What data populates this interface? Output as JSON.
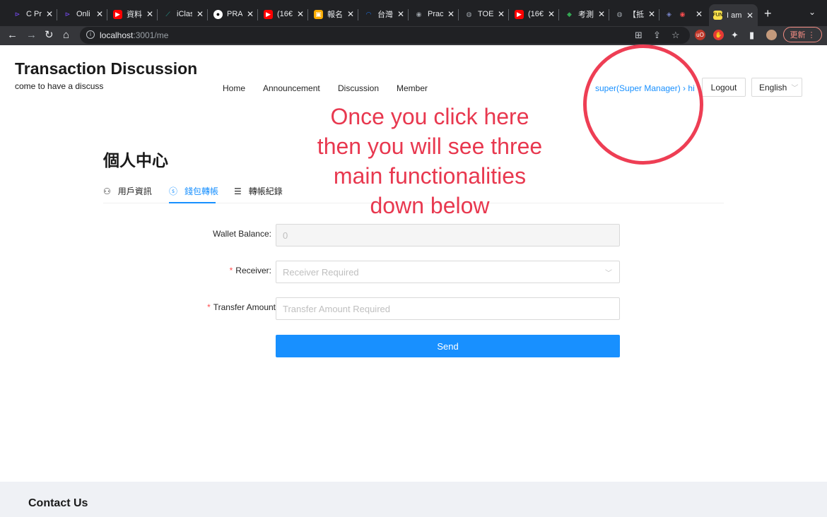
{
  "browser": {
    "tabs": [
      {
        "label": "C Pr",
        "icon": "purple-p-icon",
        "color": "#7c4dff"
      },
      {
        "label": "Onli",
        "icon": "purple-p-icon",
        "color": "#7c4dff"
      },
      {
        "label": "資料",
        "icon": "youtube-icon",
        "color": "#ff0000"
      },
      {
        "label": "iClas",
        "icon": "iclass-icon",
        "color": "#26a69a"
      },
      {
        "label": "PRA",
        "icon": "github-icon",
        "color": "#ffffff"
      },
      {
        "label": "(16€",
        "icon": "youtube-icon",
        "color": "#ff0000"
      },
      {
        "label": "報名",
        "icon": "photo-icon",
        "color": "#f9ab00"
      },
      {
        "label": "台灣",
        "icon": "swoosh-icon",
        "color": "#1a73e8"
      },
      {
        "label": "Prac",
        "icon": "ets-icon",
        "color": "#9aa0a6"
      },
      {
        "label": "TOE",
        "icon": "globe-icon",
        "color": "#9aa0a6"
      },
      {
        "label": "(16€",
        "icon": "youtube-icon",
        "color": "#ff0000"
      },
      {
        "label": "考測",
        "icon": "leaf-icon",
        "color": "#34a853"
      },
      {
        "label": "【抵",
        "icon": "globe-icon",
        "color": "#9aa0a6"
      }
    ],
    "active_tab_label": "I am",
    "url_host": "localhost",
    "url_rest": ":3001/me",
    "update_label": "更新"
  },
  "site": {
    "title": "Transaction Discussion",
    "subtitle": "come to have a discuss",
    "nav": [
      "Home",
      "Announcement",
      "Discussion",
      "Member"
    ],
    "user_link": "super(Super Manager) › hi",
    "logout_label": "Logout",
    "language_label": "English"
  },
  "annotation": {
    "lines": [
      "Once you click here",
      "then you will see three",
      "main functionalities",
      "down below"
    ],
    "color": "#e8384f"
  },
  "profile": {
    "title": "個人中心",
    "tabs": [
      {
        "label": "用戶資訊",
        "icon": "user-icon"
      },
      {
        "label": "錢包轉帳",
        "icon": "dollar-icon"
      },
      {
        "label": "轉帳紀錄",
        "icon": "list-icon"
      }
    ],
    "active_tab": "錢包轉帳"
  },
  "form": {
    "wallet_label": "Wallet Balance",
    "wallet_value": "0",
    "receiver_label": "Receiver",
    "receiver_placeholder": "Receiver Required",
    "amount_label": "Transfer Amount",
    "amount_placeholder": "Transfer Amount Required",
    "send_label": "Send",
    "accent": "#1890ff"
  },
  "footer": {
    "title": "Contact Us"
  }
}
